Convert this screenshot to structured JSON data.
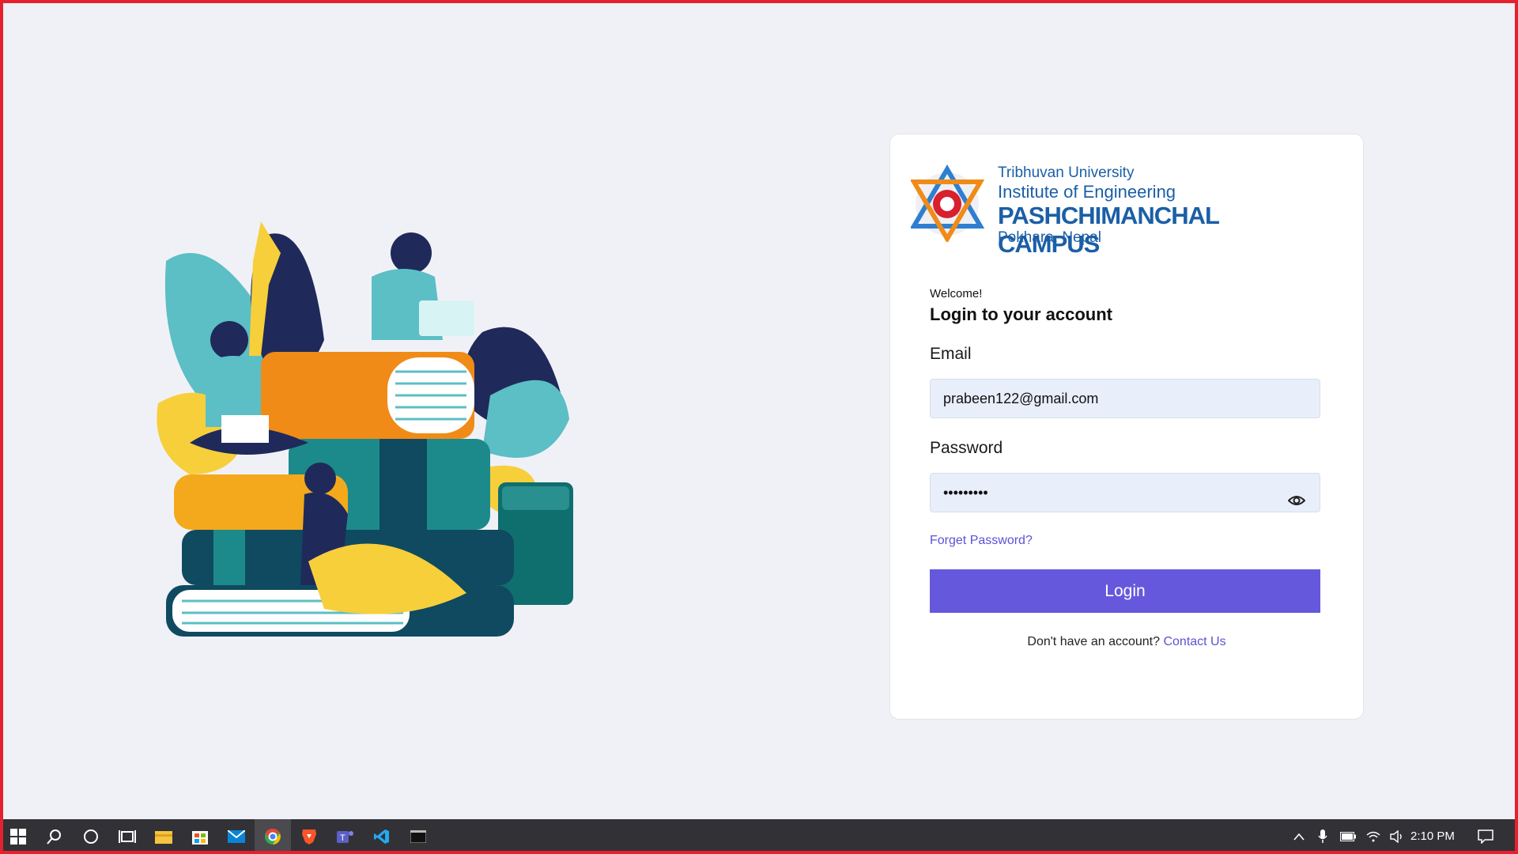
{
  "logo": {
    "line1": "Tribhuvan University",
    "line2": "Institute of Engineering",
    "line3": "PASHCHIMANCHAL CAMPUS",
    "line4": "Pokhara, Nepal"
  },
  "login": {
    "welcome": "Welcome!",
    "title": "Login to your account",
    "email_label": "Email",
    "email_value": "prabeen122@gmail.com",
    "password_label": "Password",
    "password_value": "•••••••••",
    "forgot_link": "Forget Password?",
    "login_button": "Login",
    "signup_prompt": "Don't have an account?",
    "signup_link": "Contact Us"
  },
  "taskbar": {
    "clock": "2:10 PM",
    "apps": [
      "windows-start-icon",
      "search-icon",
      "cortana-icon",
      "task-view-icon",
      "file-explorer-icon",
      "store-icon",
      "mail-icon",
      "chrome-icon",
      "brave-icon",
      "teams-icon",
      "vscode-icon",
      "terminal-icon"
    ],
    "tray": [
      "chevron-up-icon",
      "microphone-icon",
      "battery-icon",
      "wifi-icon",
      "volume-icon",
      "notification-icon"
    ]
  },
  "colors": {
    "primary": "#6558dc",
    "link": "#5b52d6",
    "input_bg": "#e8eefa",
    "page_bg": "#f0f1f7",
    "frame": "#e5212e"
  }
}
